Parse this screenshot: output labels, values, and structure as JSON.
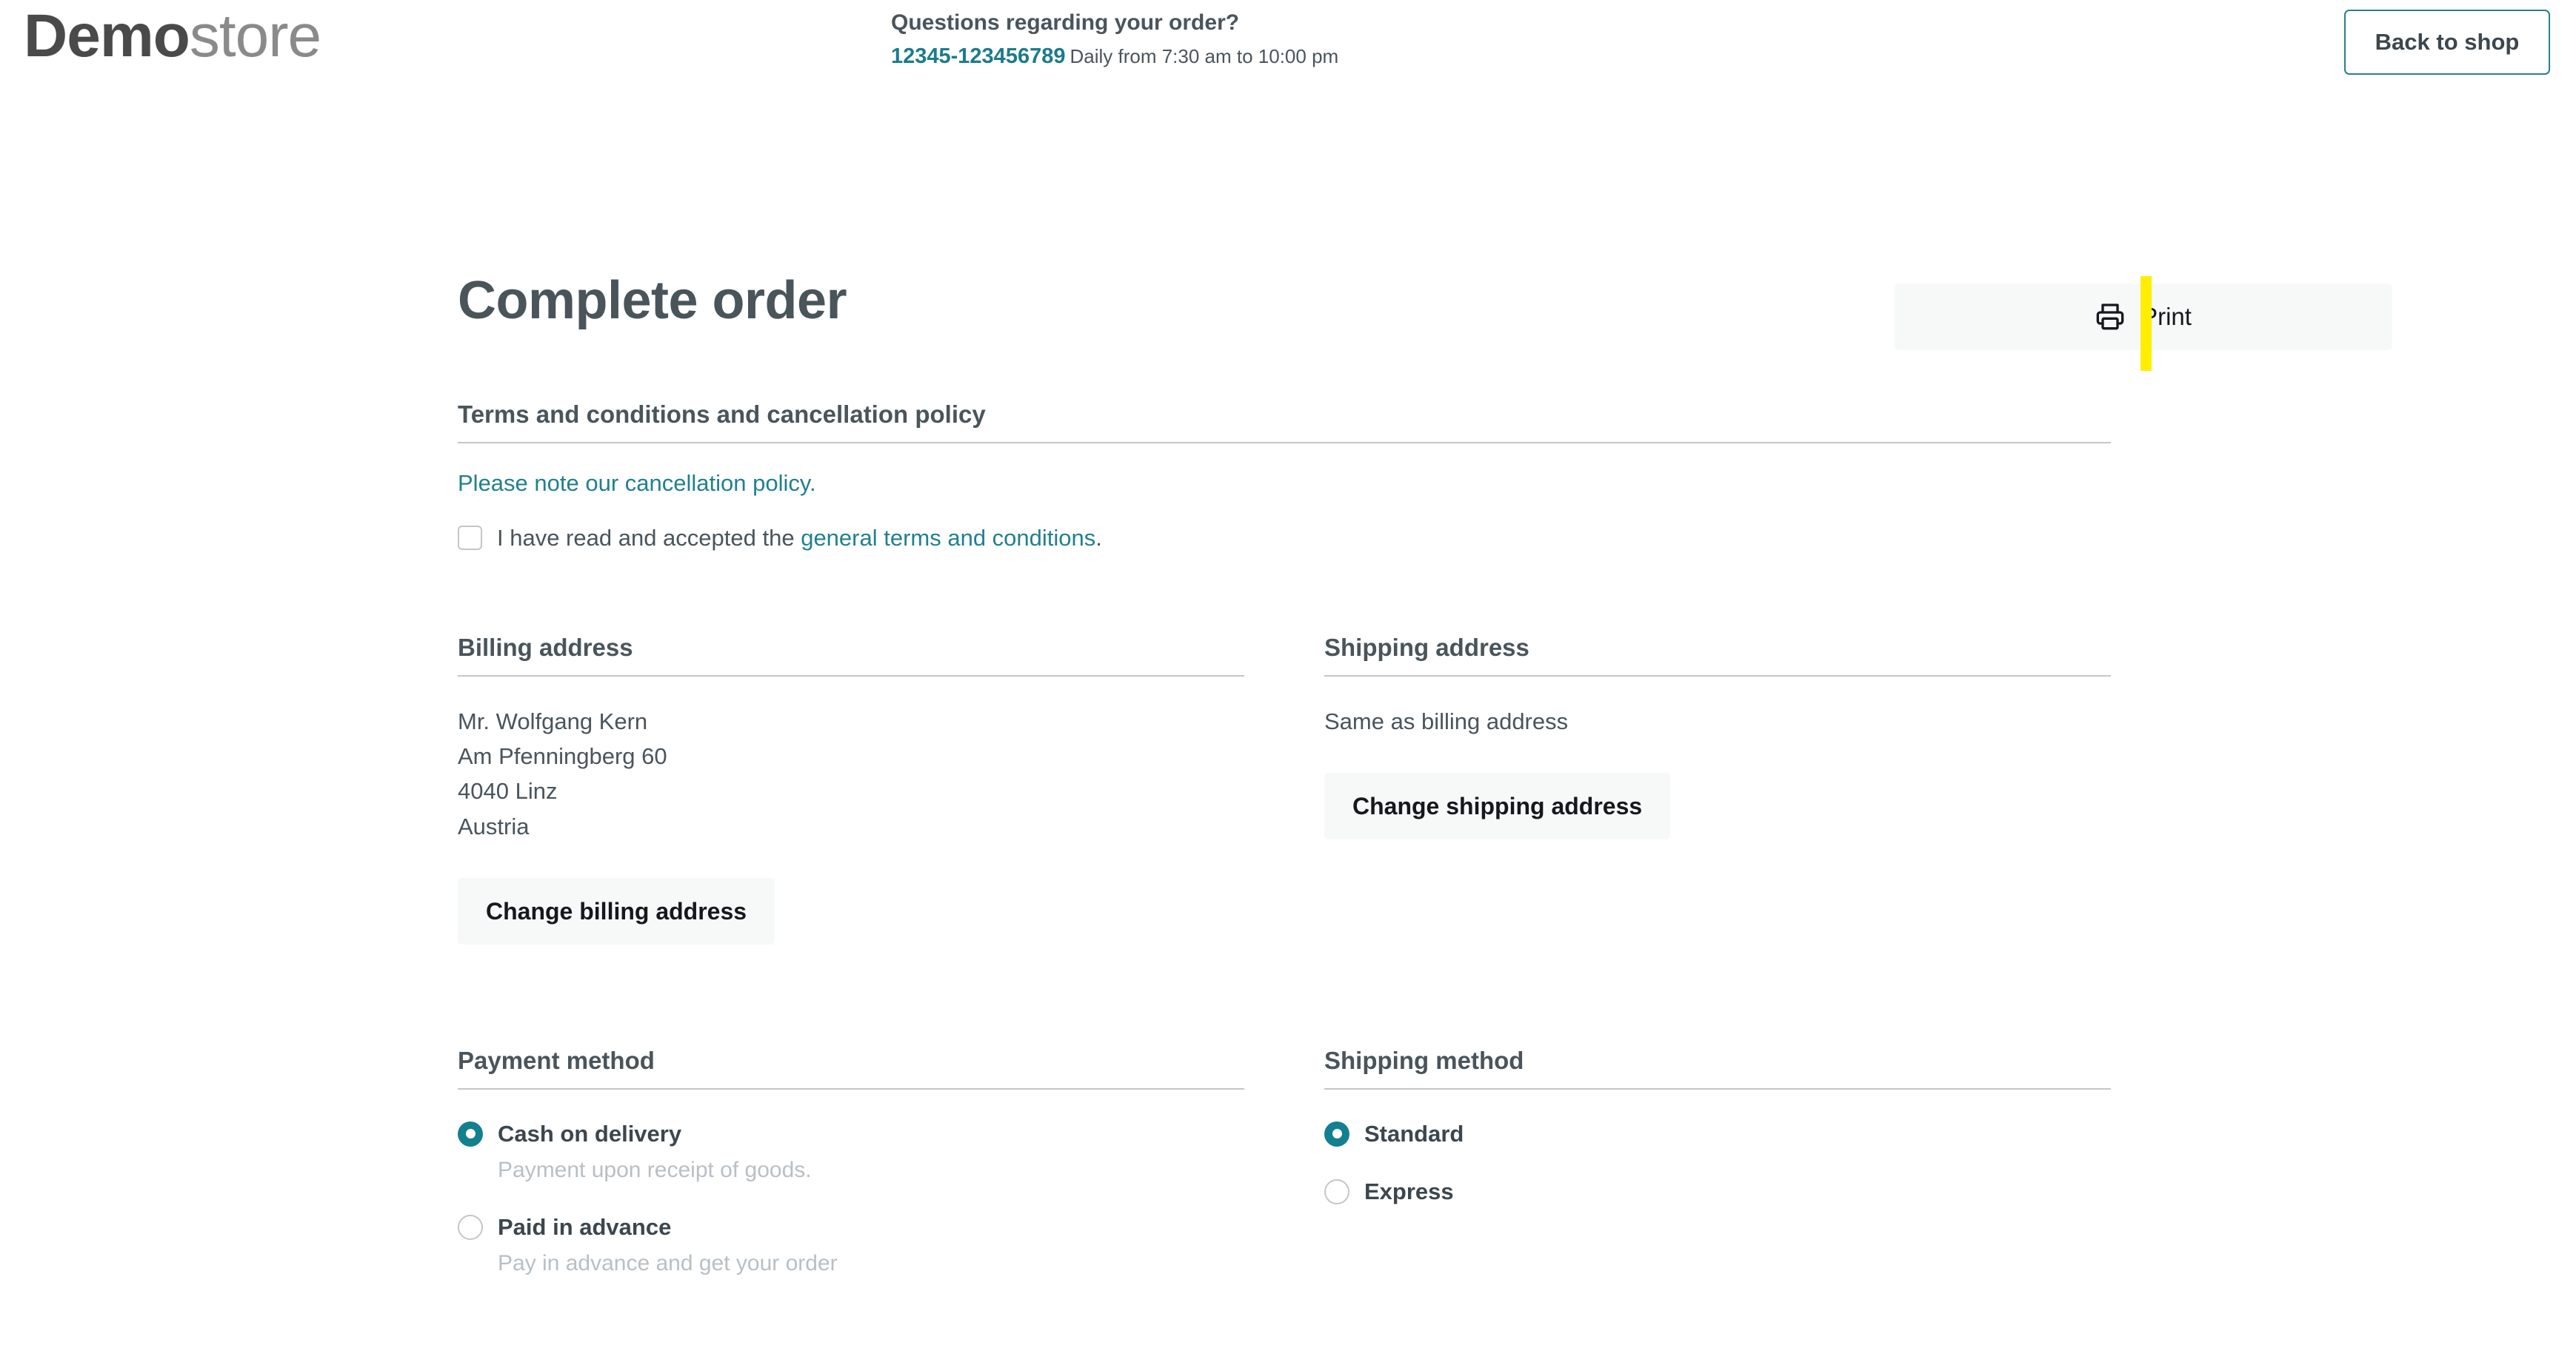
{
  "header": {
    "logo_bold": "Demo",
    "logo_light": "store",
    "contact_question": "Questions regarding your order?",
    "contact_phone": "12345-123456789",
    "contact_hours": "Daily from 7:30 am to 10:00 pm",
    "back_to_shop_label": "Back to shop",
    "accent_teal": "#2a7f8e"
  },
  "main": {
    "page_title": "Complete order",
    "print_label": "Print",
    "print_icon": "printer-icon",
    "accent_yellow": "#ffee00"
  },
  "terms": {
    "heading": "Terms and conditions and cancellation policy",
    "cancellation_link": "Please note our cancellation policy.",
    "checkbox_checked": false,
    "consent_prefix": "I have read and accepted the ",
    "consent_link": "general terms and conditions",
    "consent_suffix": ".",
    "link_color": "#21808f"
  },
  "billing": {
    "heading": "Billing address",
    "lines": [
      "Mr. Wolfgang Kern",
      "Am Pfenningberg 60",
      "4040 Linz",
      "Austria"
    ],
    "change_button_label": "Change billing address"
  },
  "shipping": {
    "heading": "Shipping address",
    "lines": [
      "Same as billing address"
    ],
    "change_button_label": "Change shipping address"
  },
  "payment_method": {
    "heading": "Payment method",
    "options": [
      {
        "label": "Cash on delivery",
        "description": "Payment upon receipt of goods.",
        "selected": true
      },
      {
        "label": "Paid in advance",
        "description": "Pay in advance and get your order",
        "selected": false
      }
    ]
  },
  "shipping_method": {
    "heading": "Shipping method",
    "options": [
      {
        "label": "Standard",
        "description": "",
        "selected": true
      },
      {
        "label": "Express",
        "description": "",
        "selected": false
      }
    ],
    "selected_color": "#12808f"
  }
}
